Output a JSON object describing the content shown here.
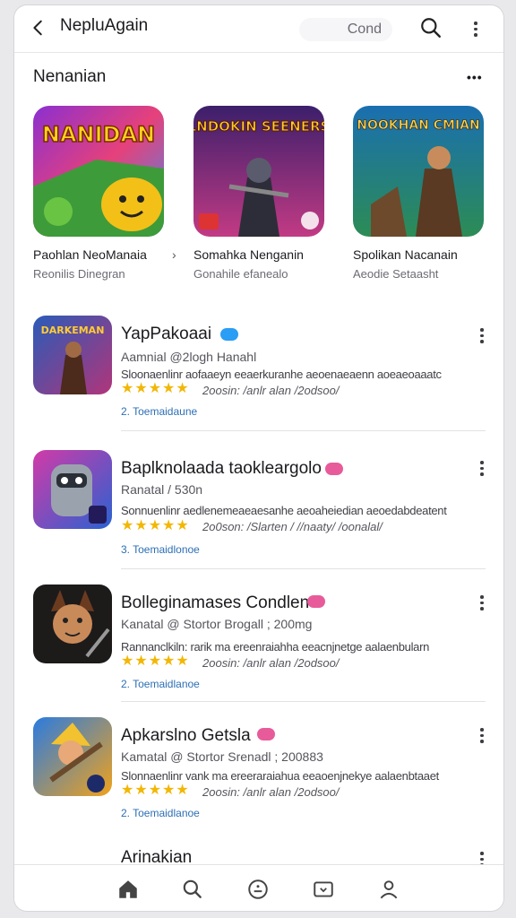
{
  "header": {
    "title": "NepluAgain",
    "search_placeholder": "Cond"
  },
  "section": {
    "title": "Nenanian",
    "more_label": "•••"
  },
  "cards": [
    {
      "name": "Paohlan NeoManaia",
      "sub": "Reonilis Dinegran",
      "art_title": "NANIDAN"
    },
    {
      "name": "Somahka Nenganin",
      "sub": "Gonahile efanealo",
      "art_title": "DLNDOKIN SEENERSH"
    },
    {
      "name": "Spolikan Nacanain",
      "sub": "Aeodie Setaasht",
      "art_title": "NOOKHAN CMIAN"
    }
  ],
  "chevron": "›",
  "list": [
    {
      "name": "YapPakoaai",
      "badge_color": "#2a9df4",
      "meta": "Aamnial @2logh  Hanahl",
      "desc": "Sloonaenlinr aofaaeyn eeaerkuranhe aeoenaeaenn aoeaeoaaatc",
      "stars": "★★★★★",
      "rating_text": "2oosin: /anlr alan /2odsoo/",
      "category": "2. Toemaidaune",
      "art_title": "DARKEMAN"
    },
    {
      "name": "Baplknolaada taokleargolo",
      "badge_color": "#e85b9a",
      "meta": "Ranatal / 530n",
      "desc": "Sonnuenlinr aedlenemeaeaesanhe aeoaheiedian aeoedabdeatent",
      "stars": "★★★★★",
      "rating_text": "2o0son: /Slarten / //naaty/ /oonalal/",
      "category": "3. Toemaidlonoe",
      "art_title": ""
    },
    {
      "name": "Bolleginamases Condlen",
      "badge_color": "#e85b9a",
      "meta": "Kanatal @ Stortor  Brogall ;  200mg",
      "desc": "Rannanclkiln: rarik ma ereenraiahha eeacnjnetge aalaenbularn",
      "stars": "★★★★★",
      "rating_text": "2oosin: /anlr alan /2odsoo/",
      "category": "2. Toemaidlanoe",
      "art_title": ""
    },
    {
      "name": "Apkarslno Getsla",
      "badge_color": "#e85b9a",
      "meta": "Kamatal @ Stortor  Srenadl ;  200883",
      "desc": "Slonnaenlinr vank ma ereeraraiahua eeaoenjnekye aalaenbtaaet",
      "stars": "★★★★★",
      "rating_text": "2oosin: /anlr alan /2odsoo/",
      "category": "2. Toemaidlanoe",
      "art_title": ""
    }
  ],
  "peek_title": "Arinakian",
  "nav": [
    "home-icon",
    "search-icon",
    "games-icon",
    "apps-icon",
    "profile-icon"
  ]
}
